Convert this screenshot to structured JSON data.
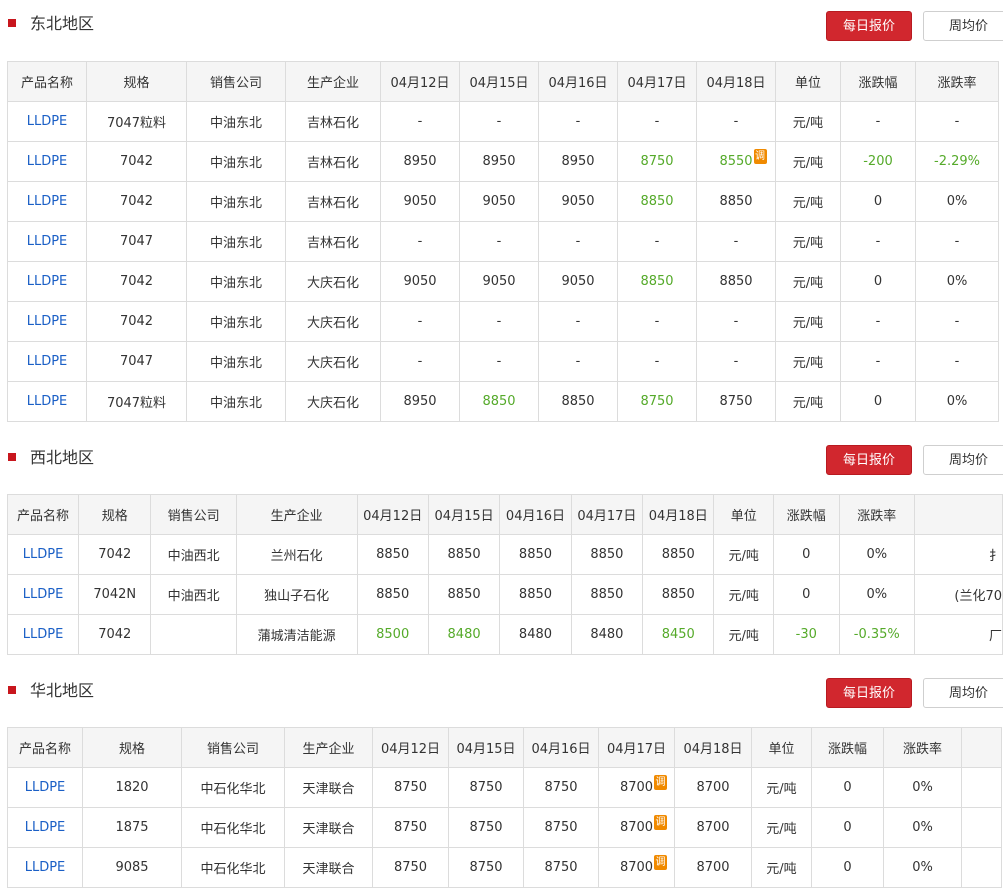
{
  "buttons": {
    "daily": "每日报价",
    "weekly": "周均价"
  },
  "colors": {
    "accent": "#d1272e",
    "link": "#1a5fc6",
    "down": "#55aa2a",
    "badge": "#f08a00"
  },
  "adjust_badge": "调",
  "sections": [
    {
      "title": "东北地区",
      "headers": [
        "产品名称",
        "规格",
        "销售公司",
        "生产企业",
        "04月12日",
        "04月15日",
        "04月16日",
        "04月17日",
        "04月18日",
        "单位",
        "涨跌幅",
        "涨跌率"
      ],
      "rows": [
        [
          "LLDPE",
          "7047粒料",
          "中油东北",
          "吉林石化",
          "-",
          "-",
          "-",
          "-",
          "-",
          "元/吨",
          "-",
          "-"
        ],
        [
          "LLDPE",
          "7042",
          "中油东北",
          "吉林石化",
          "8950",
          "8950",
          "8950",
          "8750",
          "8550",
          "元/吨",
          "-200",
          "-2.29%"
        ],
        [
          "LLDPE",
          "7042",
          "中油东北",
          "吉林石化",
          "9050",
          "9050",
          "9050",
          "8850",
          "8850",
          "元/吨",
          "0",
          "0%"
        ],
        [
          "LLDPE",
          "7047",
          "中油东北",
          "吉林石化",
          "-",
          "-",
          "-",
          "-",
          "-",
          "元/吨",
          "-",
          "-"
        ],
        [
          "LLDPE",
          "7042",
          "中油东北",
          "大庆石化",
          "9050",
          "9050",
          "9050",
          "8850",
          "8850",
          "元/吨",
          "0",
          "0%"
        ],
        [
          "LLDPE",
          "7042",
          "中油东北",
          "大庆石化",
          "-",
          "-",
          "-",
          "-",
          "-",
          "元/吨",
          "-",
          "-"
        ],
        [
          "LLDPE",
          "7047",
          "中油东北",
          "大庆石化",
          "-",
          "-",
          "-",
          "-",
          "-",
          "元/吨",
          "-",
          "-"
        ],
        [
          "LLDPE",
          "7047粒料",
          "中油东北",
          "大庆石化",
          "8950",
          "8850",
          "8850",
          "8750",
          "8750",
          "元/吨",
          "0",
          "0%"
        ]
      ]
    },
    {
      "title": "西北地区",
      "headers": [
        "产品名称",
        "规格",
        "销售公司",
        "生产企业",
        "04月12日",
        "04月15日",
        "04月16日",
        "04月17日",
        "04月18日",
        "单位",
        "涨跌幅",
        "涨跌率",
        ""
      ],
      "rows": [
        [
          "LLDPE",
          "7042",
          "中油西北",
          "兰州石化",
          "8850",
          "8850",
          "8850",
          "8850",
          "8850",
          "元/吨",
          "0",
          "0%",
          "扌"
        ],
        [
          "LLDPE",
          "7042N",
          "中油西北",
          "独山子石化",
          "8850",
          "8850",
          "8850",
          "8850",
          "8850",
          "元/吨",
          "0",
          "0%",
          "(兰化70"
        ],
        [
          "LLDPE",
          "7042",
          "",
          "蒲城清洁能源",
          "8500",
          "8480",
          "8480",
          "8480",
          "8450",
          "元/吨",
          "-30",
          "-0.35%",
          "厂"
        ]
      ]
    },
    {
      "title": "华北地区",
      "headers": [
        "产品名称",
        "规格",
        "销售公司",
        "生产企业",
        "04月12日",
        "04月15日",
        "04月16日",
        "04月17日",
        "04月18日",
        "单位",
        "涨跌幅",
        "涨跌率",
        ""
      ],
      "rows": [
        [
          "LLDPE",
          "1820",
          "中石化华北",
          "天津联合",
          "8750",
          "8750",
          "8750",
          "8700",
          "8700",
          "元/吨",
          "0",
          "0%",
          ""
        ],
        [
          "LLDPE",
          "1875",
          "中石化华北",
          "天津联合",
          "8750",
          "8750",
          "8750",
          "8700",
          "8700",
          "元/吨",
          "0",
          "0%",
          ""
        ],
        [
          "LLDPE",
          "9085",
          "中石化华北",
          "天津联合",
          "8750",
          "8750",
          "8750",
          "8700",
          "8700",
          "元/吨",
          "0",
          "0%",
          ""
        ]
      ]
    }
  ]
}
